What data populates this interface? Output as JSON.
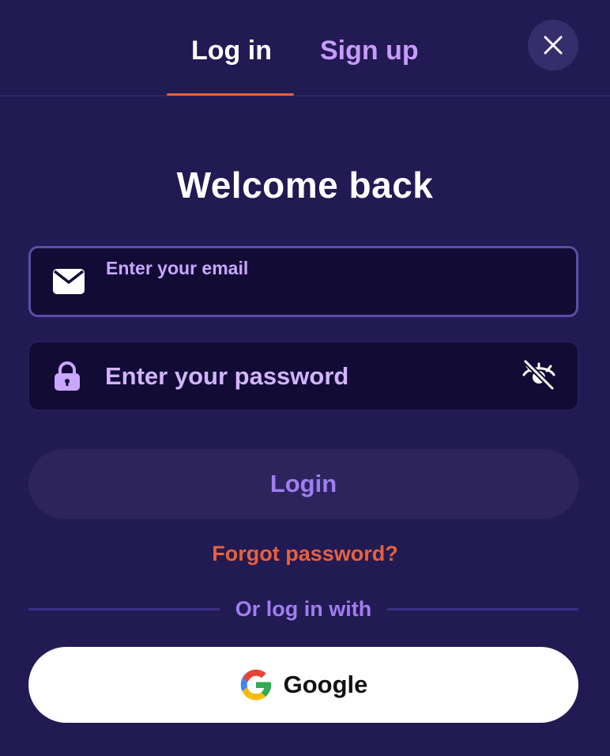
{
  "tabs": {
    "login_label": "Log in",
    "signup_label": "Sign up",
    "active": "login"
  },
  "close": {
    "icon": "close-icon"
  },
  "title": "Welcome back",
  "email_field": {
    "label": "Enter your email",
    "value": "",
    "icon": "envelope-icon"
  },
  "password_field": {
    "placeholder": "Enter your password",
    "value": "",
    "icon": "lock-icon",
    "toggle_icon": "eye-slash-icon"
  },
  "login_button": {
    "label": "Login"
  },
  "forgot_link": "Forgot password?",
  "divider_text": "Or log in with",
  "google_button": {
    "label": "Google",
    "icon": "google-icon"
  },
  "colors": {
    "background": "#221a52",
    "accent": "#e8613a",
    "tab_inactive": "#c79bff",
    "field_background": "#120b35",
    "button_text": "#a07ef0"
  }
}
